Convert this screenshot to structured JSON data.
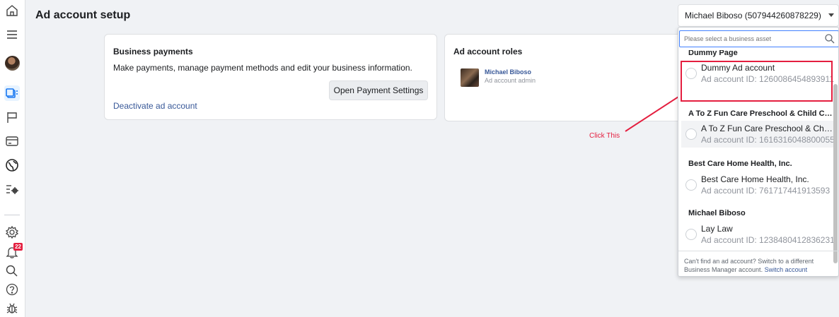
{
  "page": {
    "title": "Ad account setup"
  },
  "account_selector": {
    "value": "Michael Biboso (507944260878229)"
  },
  "payments_card": {
    "title": "Business payments",
    "description": "Make payments, manage payment methods and edit your business information.",
    "button_label": "Open Payment Settings",
    "link_label": "Deactivate ad account"
  },
  "roles_card": {
    "title": "Ad account roles",
    "person_name": "Michael Biboso",
    "person_role": "Ad account admin"
  },
  "annotation": {
    "text": "Click This",
    "color": "#e41e3f"
  },
  "nav": {
    "notification_count": "22"
  },
  "dropdown": {
    "placeholder": "Please select a business asset",
    "groups": [
      {
        "label": "Dummy Page",
        "options": [
          {
            "name": "Dummy Ad account",
            "id": "Ad account ID: 1260086454893911"
          }
        ]
      },
      {
        "label": "A To Z Fun Care Preschool & Child Ca...",
        "options": [
          {
            "name": "A To Z Fun Care Preschool & Child C...",
            "id": "Ad account ID: 1616316048800055"
          }
        ]
      },
      {
        "label": "Best Care Home Health, Inc.",
        "options": [
          {
            "name": "Best Care Home Health, Inc.",
            "id": "Ad account ID: 761717441913593"
          }
        ]
      },
      {
        "label": "Michael Biboso",
        "options": [
          {
            "name": "Lay Law",
            "id": "Ad account ID: 1238480412836231"
          }
        ]
      }
    ],
    "footer_text": "Can't find an ad account? Switch to a different Business Manager account.",
    "footer_link": "Switch account"
  },
  "colors": {
    "link": "#385898",
    "accent": "#1877f2",
    "alert": "#e41e3f"
  }
}
